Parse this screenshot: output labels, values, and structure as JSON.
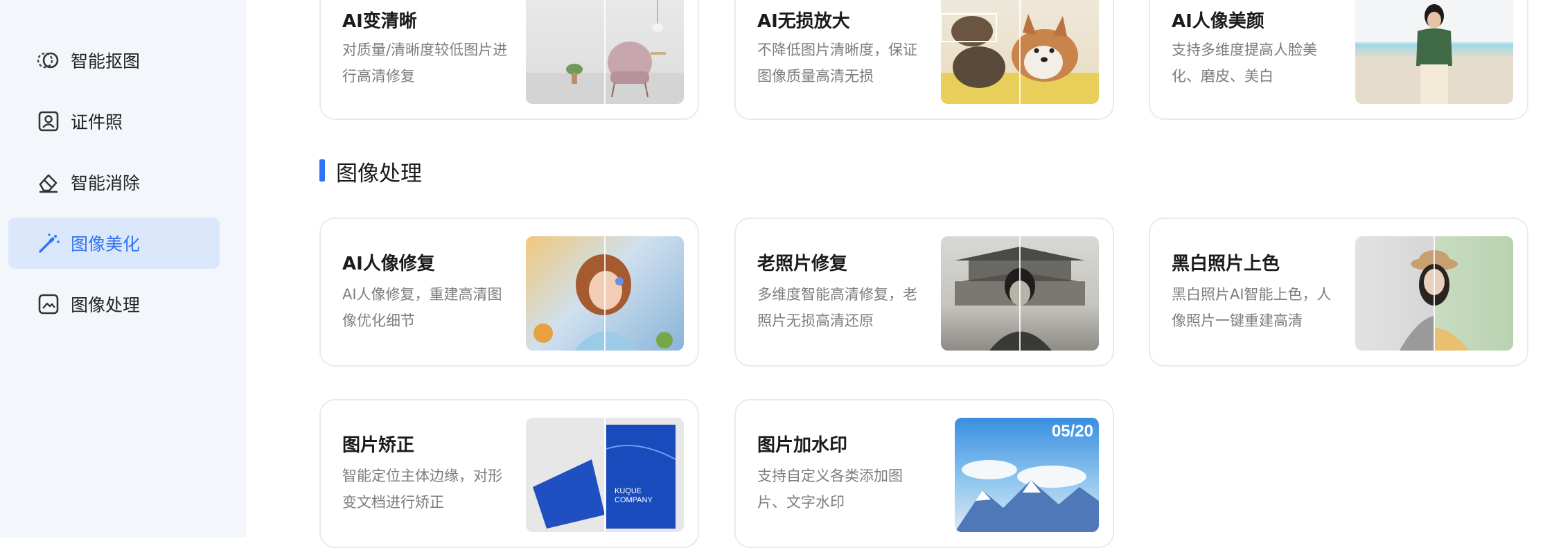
{
  "sidebar": {
    "items": [
      {
        "label": "智能抠图",
        "icon": "cutout-icon",
        "active": false
      },
      {
        "label": "证件照",
        "icon": "id-photo-icon",
        "active": false
      },
      {
        "label": "智能消除",
        "icon": "eraser-icon",
        "active": false
      },
      {
        "label": "图像美化",
        "icon": "magic-wand-icon",
        "active": true
      },
      {
        "label": "图像处理",
        "icon": "image-process-icon",
        "active": false
      }
    ]
  },
  "top_row": [
    {
      "title": "AI变清晰",
      "desc": "对质量/清晰度较低图片进行高清修复"
    },
    {
      "title": "AI无损放大",
      "desc": "不降低图片清晰度，保证图像质量高清无损"
    },
    {
      "title": "AI人像美颜",
      "desc": "支持多维度提高人脸美化、磨皮、美白"
    }
  ],
  "section": {
    "title": "图像处理"
  },
  "row2": [
    {
      "title": "AI人像修复",
      "desc": "AI人像修复，重建高清图像优化细节"
    },
    {
      "title": "老照片修复",
      "desc": "多维度智能高清修复，老照片无损高清还原"
    },
    {
      "title": "黑白照片上色",
      "desc": "黑白照片AI智能上色，人像照片一键重建高清"
    }
  ],
  "row3": [
    {
      "title": "图片矫正",
      "desc": "智能定位主体边缘，对形变文档进行矫正",
      "thumb_text": "KUQUE COMPANY"
    },
    {
      "title": "图片加水印",
      "desc": "支持自定义各类添加图片、文字水印",
      "thumb_text": "05/20"
    }
  ],
  "colors": {
    "accent": "#2f74f5",
    "active_bg": "#dbe8fc",
    "sidebar_bg": "#f3f6fb"
  }
}
